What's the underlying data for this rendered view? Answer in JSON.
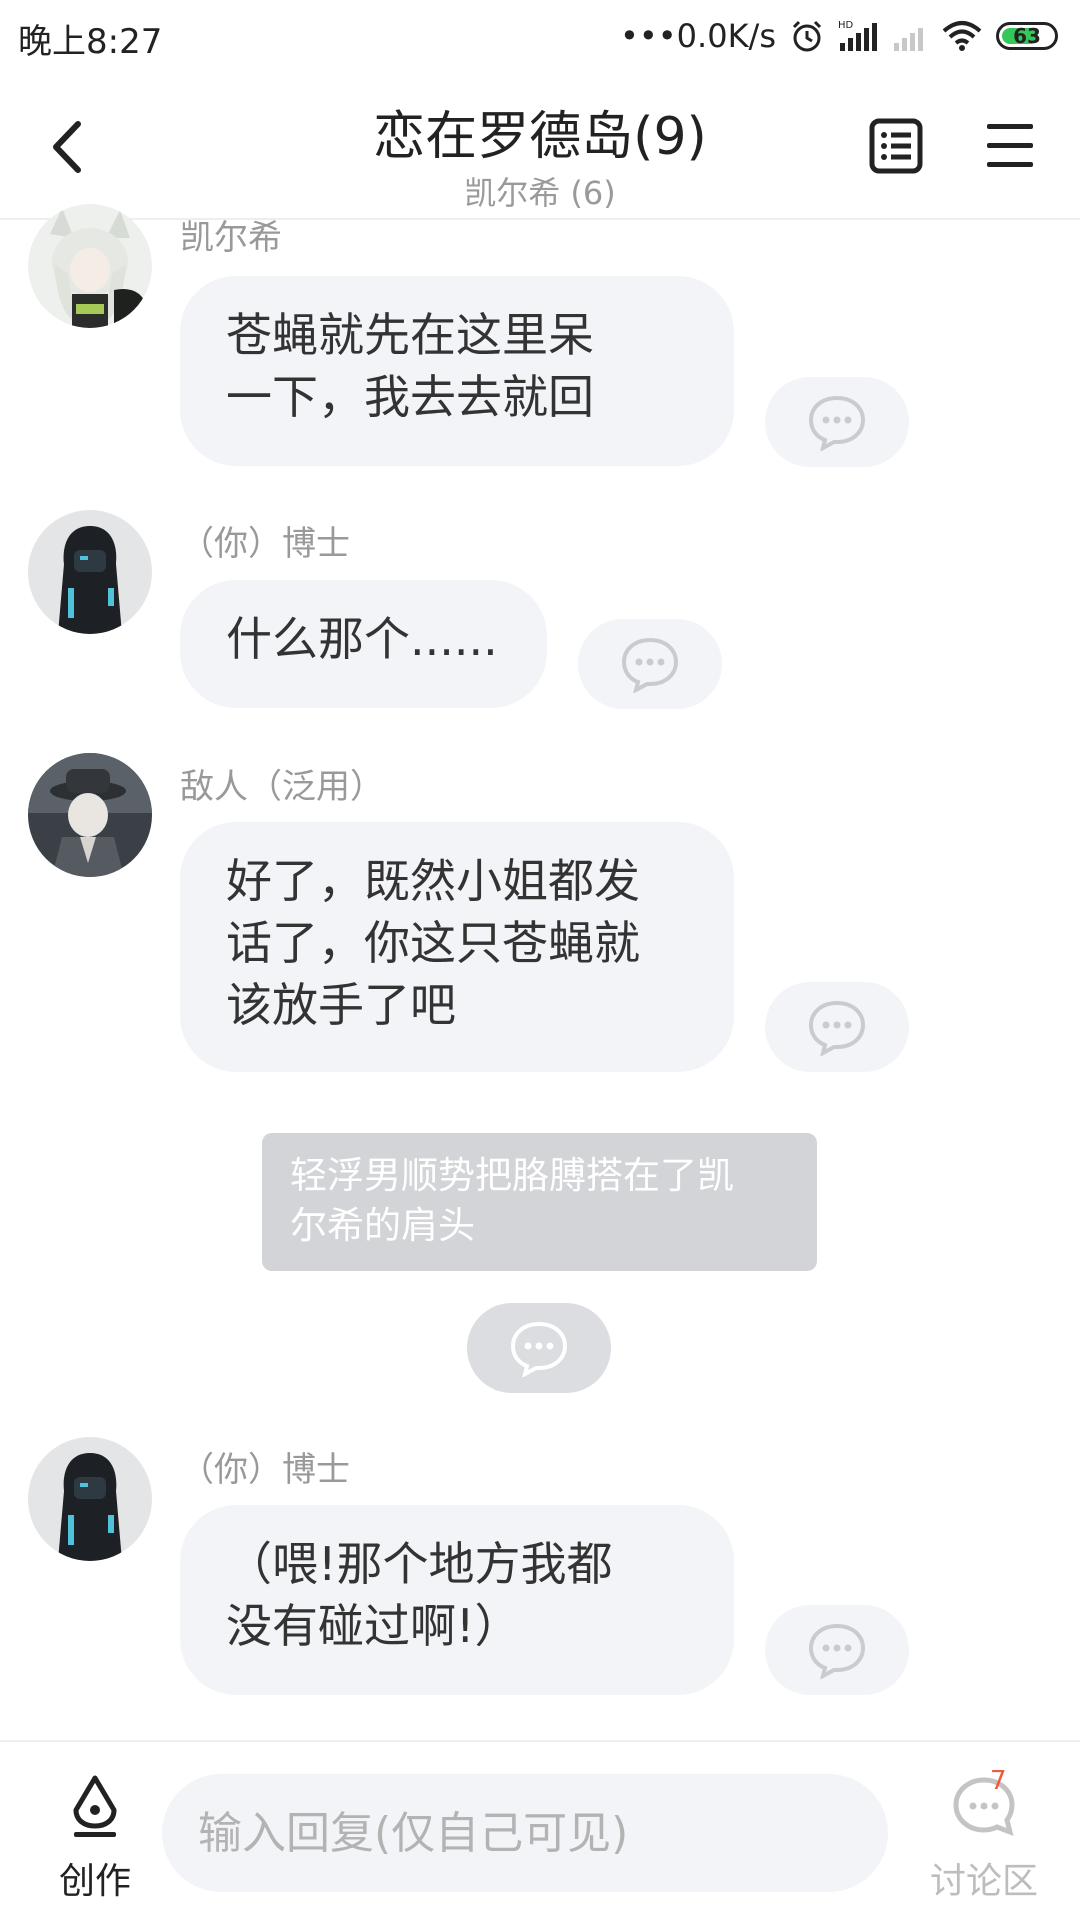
{
  "status": {
    "time": "晚上8:27",
    "network": "•••0.0K/s",
    "battery": "63"
  },
  "nav": {
    "title": "恋在罗德岛(9)",
    "subtitle": "凯尔希 (6)"
  },
  "messages": [
    {
      "sender": "凯尔希",
      "text": "苍蝇就先在这里呆\n一下，我去去就回"
    },
    {
      "sender": "（你）博士",
      "text": "什么那个......"
    },
    {
      "sender": "敌人（泛用）",
      "text": "好了，既然小姐都发\n话了，你这只苍蝇就\n该放手了吧"
    },
    {
      "sender": "（你）博士",
      "text": "（喂!那个地方我都\n没有碰过啊!）"
    }
  ],
  "narration": {
    "text": "轻浮男顺势把胳膊搭在了凯\n尔希的肩头"
  },
  "bottom": {
    "create_label": "创作",
    "reply_placeholder": "输入回复(仅自己可见)",
    "discuss_label": "讨论区",
    "discuss_badge": "7"
  },
  "icons": {
    "back": "chevron-left-icon",
    "doc": "document-list-icon",
    "menu": "hamburger-menu-icon",
    "comment": "comment-bubble-icon",
    "create": "pen-nib-icon",
    "discuss": "discussion-icon"
  },
  "colors": {
    "bubble": "#f3f4f8",
    "narration": "#d3d4d8",
    "badge": "#f05a3c",
    "battery": "#35c759"
  }
}
